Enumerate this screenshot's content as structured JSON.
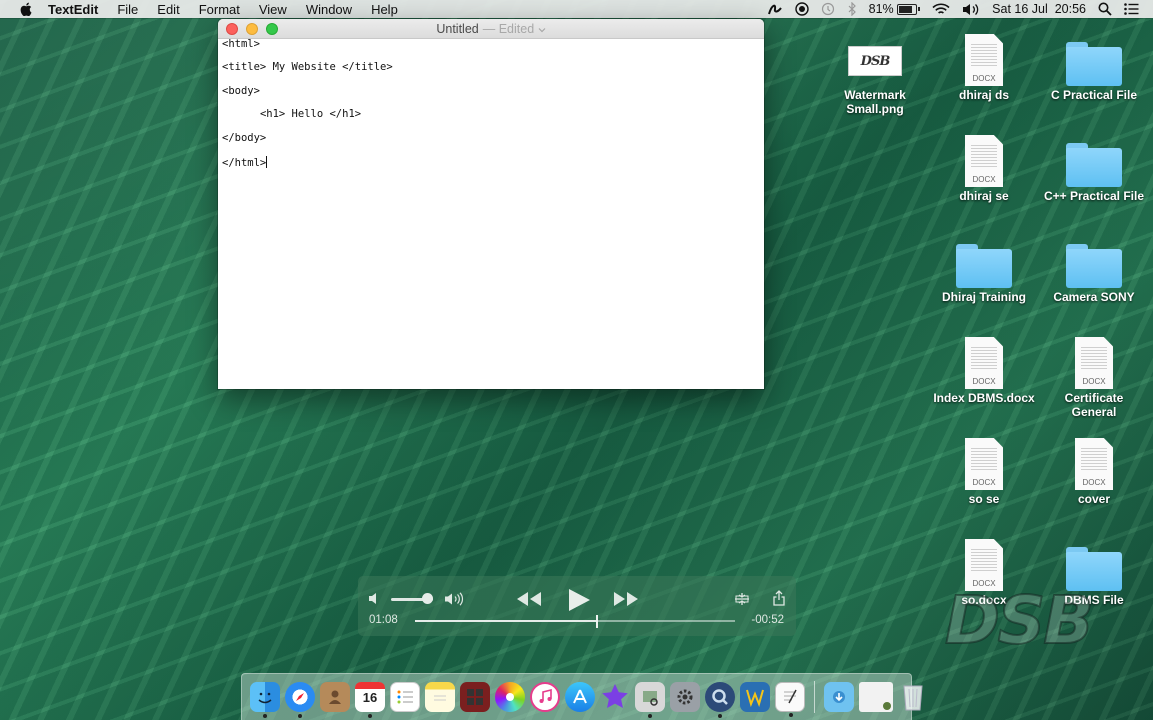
{
  "menubar": {
    "app_name": "TextEdit",
    "menus": [
      "File",
      "Edit",
      "Format",
      "View",
      "Window",
      "Help"
    ],
    "battery_percent": "81%",
    "battery_level": 0.81,
    "clock": "Sat 16 Jul  20:56"
  },
  "window": {
    "title": "Untitled",
    "status": "— Edited",
    "lines": [
      "<html>",
      "<title> My Website </title>",
      "<body>",
      "\t<h1> Hello </h1>",
      "</body>",
      "</html>"
    ]
  },
  "desktop": {
    "icons": [
      {
        "label": "Watermark Small.png",
        "kind": "png",
        "thumb_text": "DSB"
      },
      {
        "label": "dhiraj ds",
        "kind": "docx",
        "ext": "DOCX"
      },
      {
        "label": "C Practical File",
        "kind": "folder"
      },
      {
        "label": "dhiraj se",
        "kind": "docx",
        "ext": "DOCX"
      },
      {
        "label": "C++ Practical File",
        "kind": "folder"
      },
      {
        "label": "Dhiraj Training",
        "kind": "folder"
      },
      {
        "label": "Camera SONY",
        "kind": "folder"
      },
      {
        "label": "Index DBMS.docx",
        "kind": "docx",
        "ext": "DOCX"
      },
      {
        "label": "Certificate General",
        "kind": "docx",
        "ext": "DOCX"
      },
      {
        "label": "so se",
        "kind": "docx",
        "ext": "DOCX"
      },
      {
        "label": "cover",
        "kind": "docx",
        "ext": "DOCX"
      },
      {
        "label": "so.docx",
        "kind": "docx",
        "ext": "DOCX"
      },
      {
        "label": "DBMS File",
        "kind": "folder"
      }
    ],
    "watermark": "DSB"
  },
  "video": {
    "current_time": "01:08",
    "remaining_time": "-00:52",
    "progress": 0.57,
    "volume": 0.85
  },
  "dock": {
    "calendar_day": "16",
    "colors": {
      "finder": "#3fa9f5",
      "safari": "#2a8bf2",
      "accent": "#1f6b4c"
    }
  }
}
